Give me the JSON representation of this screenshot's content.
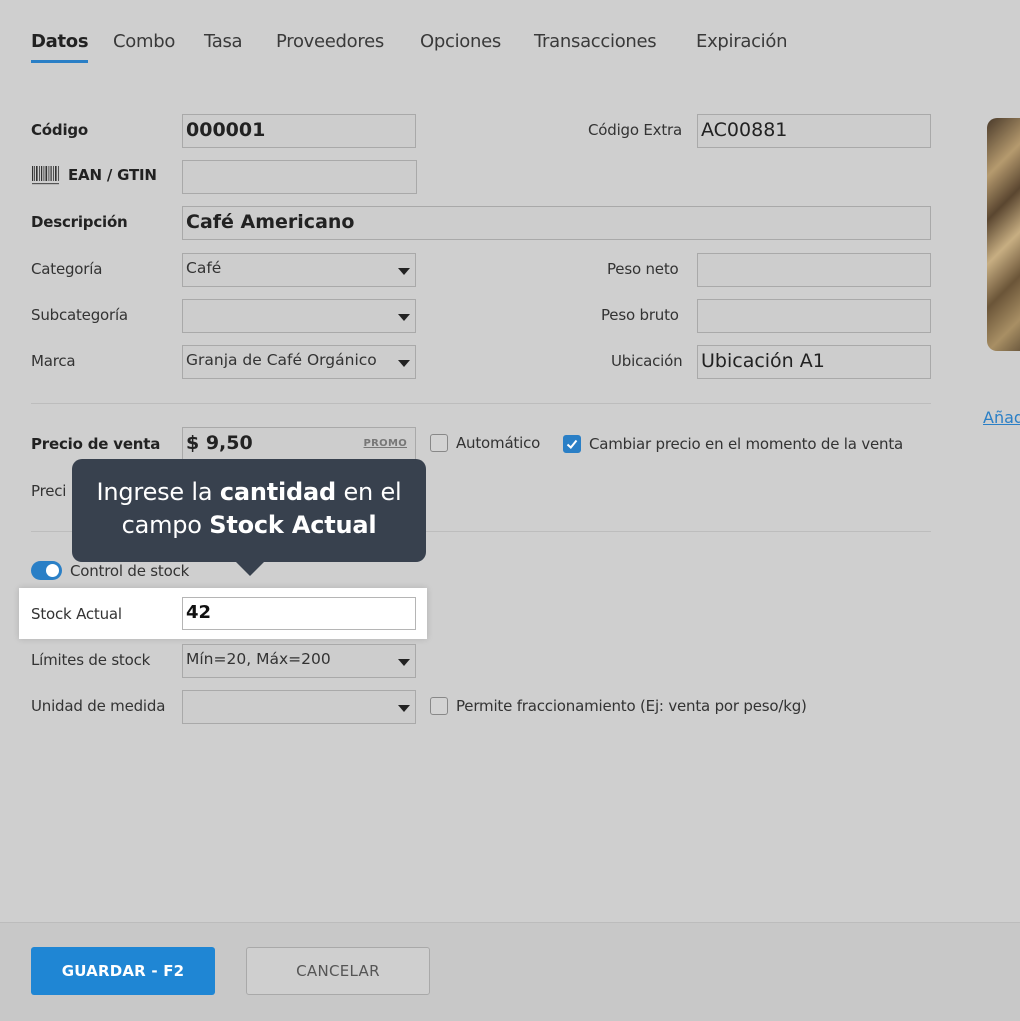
{
  "tabs": [
    {
      "label": "Datos",
      "active": true
    },
    {
      "label": "Combo"
    },
    {
      "label": "Tasa"
    },
    {
      "label": "Proveedores"
    },
    {
      "label": "Opciones"
    },
    {
      "label": "Transacciones"
    },
    {
      "label": "Expiración"
    }
  ],
  "form": {
    "codigo": {
      "label": "Código",
      "value": "000001"
    },
    "codigo_extra": {
      "label": "Código Extra",
      "value": "AC00881"
    },
    "ean": {
      "label": "EAN / GTIN",
      "value": "",
      "icon": "barcode-icon"
    },
    "descripcion": {
      "label": "Descripción",
      "value": "Café Americano"
    },
    "categoria": {
      "label": "Categoría",
      "value": "Café"
    },
    "subcategoria": {
      "label": "Subcategoría",
      "value": ""
    },
    "marca": {
      "label": "Marca",
      "value": "Granja de Café Orgánico"
    },
    "peso_neto": {
      "label": "Peso neto",
      "value": ""
    },
    "peso_bruto": {
      "label": "Peso bruto",
      "value": ""
    },
    "ubicacion": {
      "label": "Ubicación",
      "value": "Ubicación A1"
    },
    "precio_venta": {
      "label": "Precio de venta",
      "value": "$ 9,50",
      "promo": "PROMO"
    },
    "automatico": {
      "label": "Automático",
      "checked": false
    },
    "cambiar_precio": {
      "label": "Cambiar precio en el momento de la venta",
      "checked": true
    },
    "precio_partial": {
      "label": "Preci"
    },
    "control_stock": {
      "label": "Control de stock",
      "on": true
    },
    "stock_actual": {
      "label": "Stock Actual",
      "value": "42"
    },
    "limites_stock": {
      "label": "Límites de stock",
      "value": "Mín=20, Máx=200"
    },
    "unidad_medida": {
      "label": "Unidad de medida",
      "value": ""
    },
    "fraccionamiento": {
      "label": "Permite fraccionamiento (Ej: venta por peso/kg)",
      "checked": false
    }
  },
  "image_panel": {
    "add_link": "Añad"
  },
  "tooltip": {
    "part1": "Ingrese la ",
    "bold1": "cantidad",
    "part2": " en el campo ",
    "bold2": "Stock Actual"
  },
  "footer": {
    "save_label": "GUARDAR - F2",
    "cancel_label": "CANCELAR"
  },
  "colors": {
    "accent": "#2a7fc6",
    "primary_button": "#1f86d4",
    "tooltip_bg": "#38414e",
    "background": "#cfcfcf"
  }
}
